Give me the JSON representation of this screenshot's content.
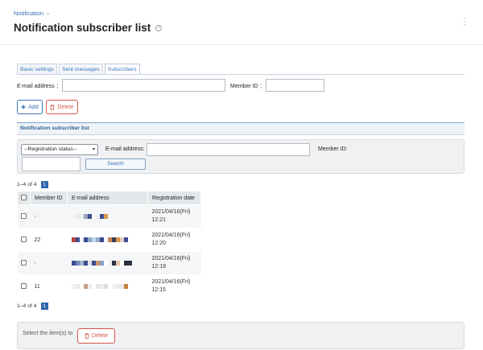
{
  "header": {
    "breadcrumb": "Notification",
    "title": "Notification subscriber list",
    "help_glyph": "?"
  },
  "tabs": [
    {
      "label": "Basic settings",
      "active": false
    },
    {
      "label": "Sent messages",
      "active": false
    },
    {
      "label": "Subscribers",
      "active": true
    }
  ],
  "top_filter": {
    "email_label": "E-mail address ：",
    "member_label": "Member ID ：",
    "email_value": "",
    "member_value": ""
  },
  "actions": {
    "add_label": "Add",
    "delete_label": "Delete"
  },
  "section": {
    "title": "Notification subscriber list"
  },
  "search": {
    "status_selected": "--Registration status--",
    "email_label": "E-mail address:",
    "member_label": "Member ID:",
    "email_value": "",
    "member_value": "",
    "button_label": "Search"
  },
  "pagination": {
    "range_text": "1–4 of 4",
    "current_page": "1"
  },
  "table": {
    "columns": [
      "Member ID",
      "E-mail address",
      "Registration date"
    ],
    "rows": [
      {
        "member_id": "-",
        "date_line1": "2021/04/16(Fri)",
        "date_line2": "12:21",
        "email_blur": [
          "#f2f3f5",
          "#e8eaed",
          "#eceef1",
          "#96a3bb",
          "#3b4d8a",
          "#ffffff",
          "#f0f1f3",
          "#3c4e94",
          "#d9944a"
        ]
      },
      {
        "member_id": "22",
        "date_line1": "2021/04/16(Fri)",
        "date_line2": "12:20",
        "email_blur": [
          "#b8433b",
          "#3e4d92",
          "#eef0f3",
          "#3b4d93",
          "#8da5c6",
          "#c3d3e6",
          "#9baac8",
          "#3a4a90",
          "#f5f6f8",
          "#c88856",
          "#3a3f52",
          "#d9944a",
          "#e4d0c4",
          "#3d4f93"
        ]
      },
      {
        "member_id": "-",
        "date_line1": "2021/04/16(Fri)",
        "date_line2": "12:19",
        "email_blur": [
          "#3b4d93",
          "#6f86b4",
          "#a3b6d3",
          "#3a4b8f",
          "#dde2ec",
          "#3c4e91",
          "#c99266",
          "#8aa0c5",
          "#ffffff",
          "#f1f2f4",
          "#2d3141",
          "#e8c4ae",
          "#ffffff",
          "#2a2f3d",
          "#2c3040"
        ]
      },
      {
        "member_id": "11",
        "date_line1": "2021/04/16(Fri)",
        "date_line2": "12:15",
        "email_blur": [
          "#eef0f2",
          "#e6e8eb",
          "#ffffff",
          "#c8a287",
          "#ebedf0",
          "#ffffff",
          "#e3e6ea",
          "#eceef1",
          "#dadde2",
          "#ffffff",
          "#f1f2f4",
          "#e6e8ec",
          "#e9ebee",
          "#c57d3d"
        ]
      }
    ]
  },
  "bottom": {
    "label": "Select the item(s) to",
    "delete_label": "Delete"
  },
  "colors": {
    "link": "#3a74b8",
    "danger": "#d5574c",
    "page_active": "#2f65ab"
  },
  "icons": {
    "breadcrumb": "chevron-down-icon",
    "help": "help-circle-icon",
    "menu": "kebab-menu-icon",
    "add": "plus-icon",
    "delete": "trash-icon"
  }
}
